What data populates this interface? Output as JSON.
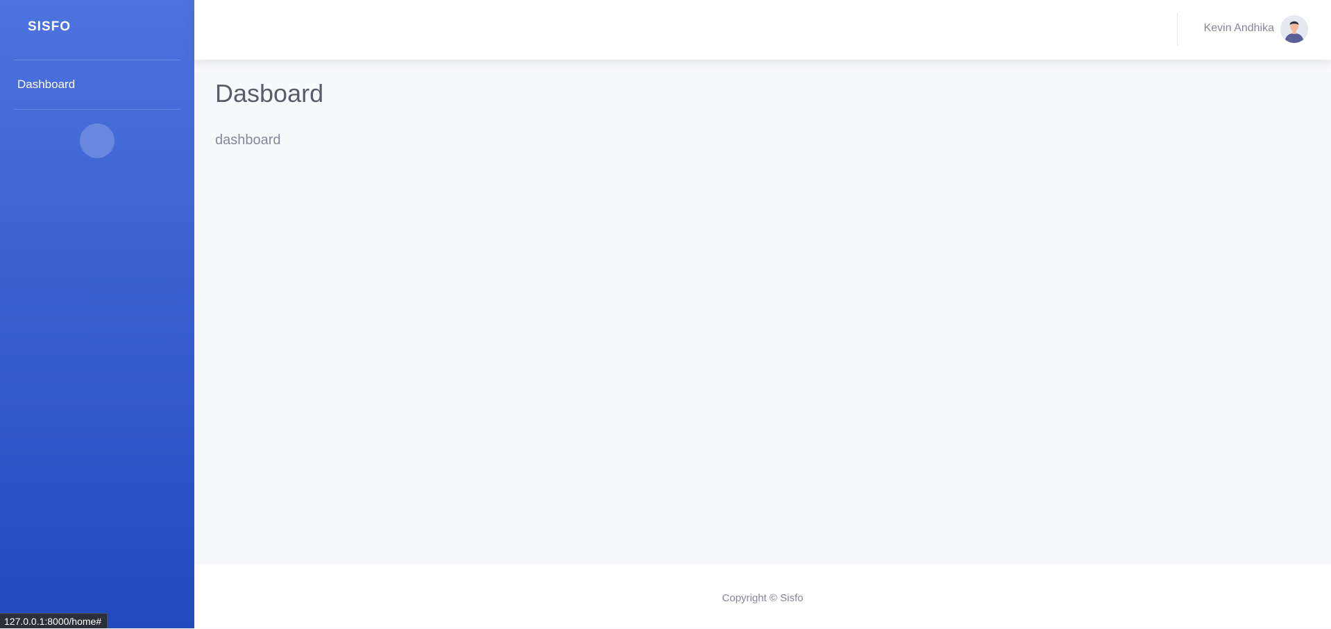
{
  "sidebar": {
    "brand": "SISFO",
    "items": [
      {
        "label": "Dashboard"
      }
    ],
    "toggle_glyph": ""
  },
  "topbar": {
    "user_name": "Kevin Andhika",
    "avatar_icon": "user-avatar-icon"
  },
  "main": {
    "title": "Dasboard",
    "text": "dashboard"
  },
  "footer": {
    "copyright": "Copyright © Sisfo"
  },
  "status_bar": {
    "url": "127.0.0.1:8000/home#"
  },
  "colors": {
    "sidebar_top": "#4e73df",
    "sidebar_bottom": "#224abe",
    "content_bg": "#f8f9fc",
    "heading": "#5a5c69",
    "muted": "#858796"
  }
}
